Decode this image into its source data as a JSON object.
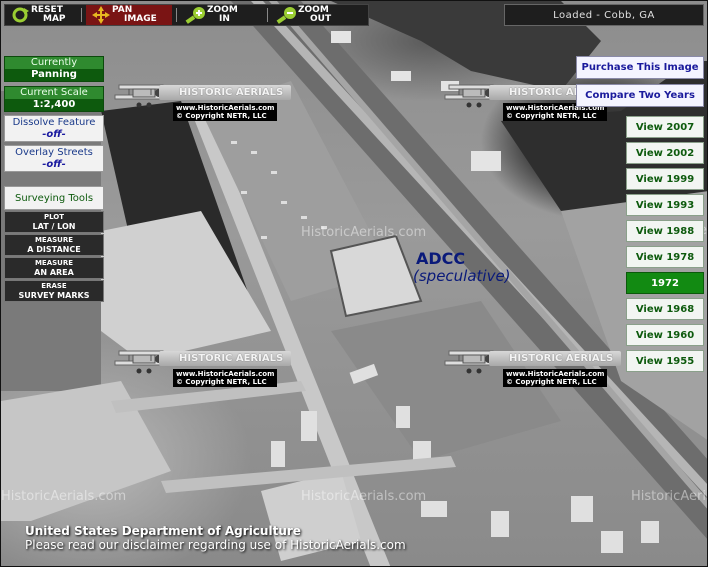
{
  "toolbar": {
    "tools": [
      {
        "name": "reset-map-button",
        "line1": "RESET",
        "line2": "MAP",
        "icon": "reset-icon"
      },
      {
        "name": "pan-image-button",
        "line1": "PAN",
        "line2": "IMAGE",
        "icon": "pan-icon"
      },
      {
        "name": "zoom-in-button",
        "line1": "ZOOM",
        "line2": "IN",
        "icon": "zoom-in-icon"
      },
      {
        "name": "zoom-out-button",
        "line1": "ZOOM",
        "line2": "OUT",
        "icon": "zoom-out-icon"
      }
    ]
  },
  "status": "Loaded - Cobb, GA",
  "left": {
    "mode_label": "Currently",
    "mode_value": "Panning",
    "scale_label": "Current Scale",
    "scale_value": "1:2,400",
    "dissolve_label": "Dissolve Feature",
    "dissolve_value": "-off-",
    "streets_label": "Overlay Streets",
    "streets_value": "-off-",
    "survey_title": "Surveying Tools",
    "survey": [
      {
        "line1": "PLOT",
        "line2": "LAT / LON"
      },
      {
        "line1": "MEASURE",
        "line2": "A DISTANCE"
      },
      {
        "line1": "MEASURE",
        "line2": "AN AREA"
      },
      {
        "line1": "ERASE",
        "line2": "SURVEY MARKS"
      }
    ]
  },
  "right": {
    "purchase": "Purchase This Image",
    "compare": "Compare Two Years",
    "years": [
      "View 2007",
      "View 2002",
      "View 1999",
      "View 1993",
      "View 1988",
      "View 1978",
      "1972",
      "View 1968",
      "View 1960",
      "View 1955"
    ],
    "selected_year": "1972"
  },
  "watermark": {
    "ribbon": "HISTORIC AERIALS",
    "url": "www.HistoricAerials.com",
    "copyright": "© Copyright NETR, LLC",
    "faint": "HistoricAerials.com"
  },
  "annotation": {
    "title": "ADCC",
    "subtitle": "(speculative)"
  },
  "footer": {
    "line1": "United States Department of Agriculture",
    "line2": "Please read our disclaimer regarding use of HistoricAerials.com"
  },
  "colors": {
    "panel_green": "#0d5a0d",
    "selected_year": "#128a12",
    "link_blue": "#1a1a9c",
    "annotation": "#0a1a7a"
  }
}
